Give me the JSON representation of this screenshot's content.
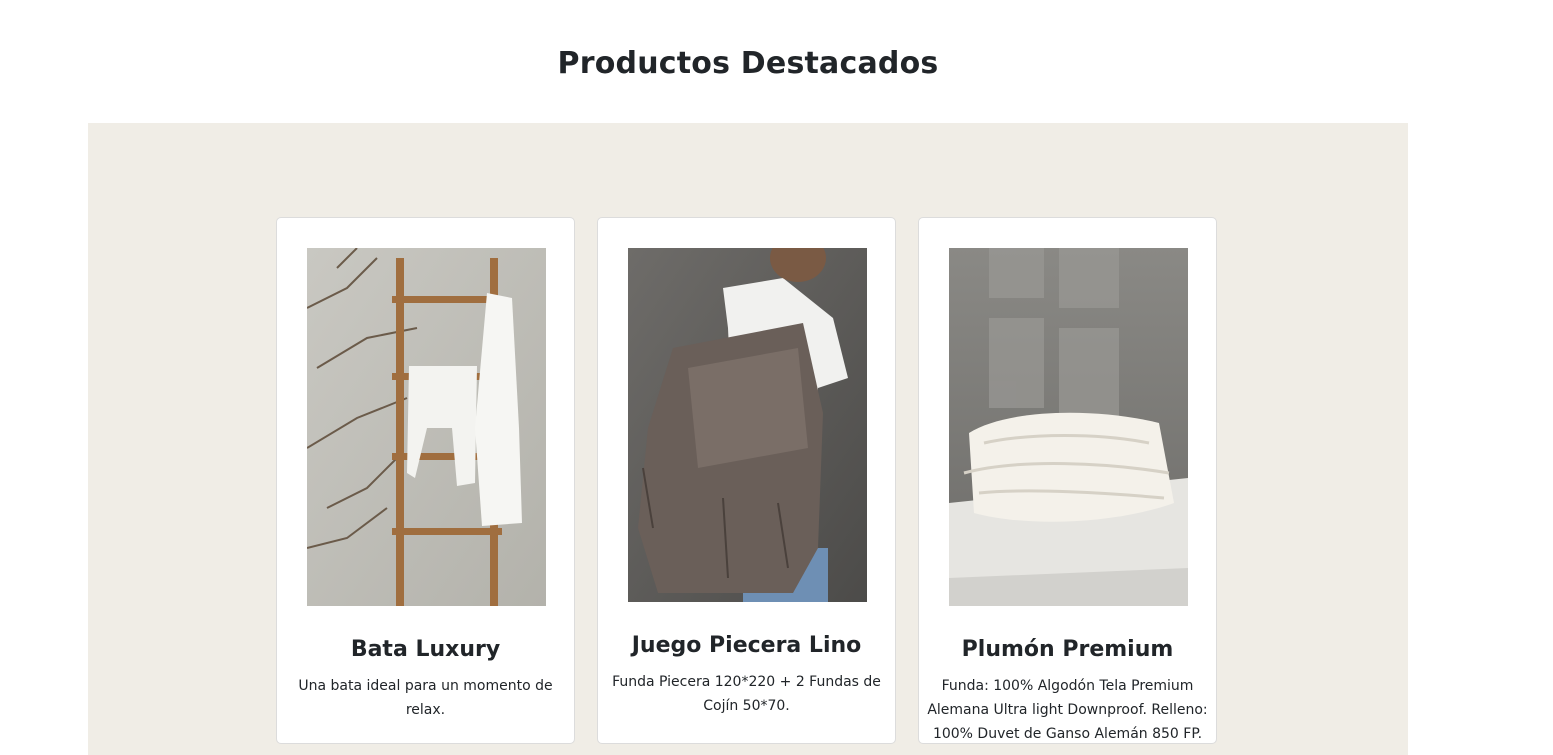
{
  "section": {
    "title": "Productos Destacados"
  },
  "products": [
    {
      "name": "Bata Luxury",
      "description": "Una bata ideal para un momento de relax."
    },
    {
      "name": "Juego Piecera Lino",
      "description": "Funda Piecera 120*220 + 2 Fundas de Cojín 50*70."
    },
    {
      "name": "Plumón Premium",
      "description": "Funda: 100% Algodón Tela Premium Alemana Ultra light Downproof. Relleno: 100% Duvet de Ganso Alemán 850 FP."
    }
  ],
  "colors": {
    "band": "#f0ede6",
    "card_border": "#dcdcdc",
    "text": "#212529"
  }
}
